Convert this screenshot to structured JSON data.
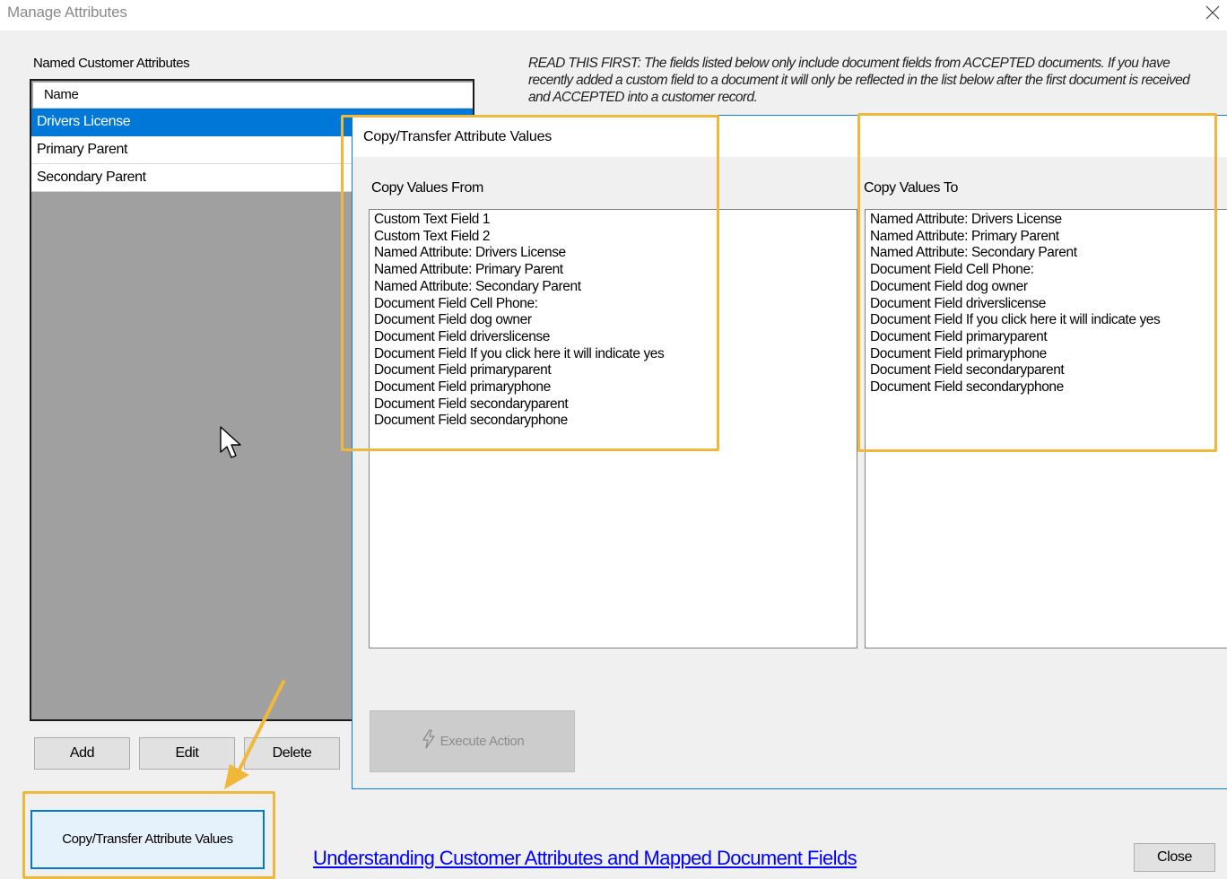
{
  "window": {
    "title": "Manage Attributes"
  },
  "attributes": {
    "heading": "Named Customer Attributes",
    "column_header": "Name",
    "items": [
      {
        "label": "Drivers License",
        "selected": true
      },
      {
        "label": "Primary Parent",
        "selected": false
      },
      {
        "label": "Secondary Parent",
        "selected": false
      }
    ]
  },
  "buttons": {
    "add": "Add",
    "edit": "Edit",
    "delete": "Delete",
    "copy_transfer": "Copy/Transfer Attribute Values",
    "close": "Close"
  },
  "help_link": "Understanding Customer Attributes and Mapped Document Fields",
  "notice": "READ THIS FIRST:  The fields listed below only include document fields from ACCEPTED documents.  If you have recently added a custom field to a document it will only be reflected in the list below after the first document is received and ACCEPTED into a customer record.",
  "dialog": {
    "title": "Copy/Transfer Attribute Values",
    "from_label": "Copy Values From",
    "to_label": "Copy Values To",
    "from_items": [
      "Custom Text Field 1",
      "Custom Text Field 2",
      "Named Attribute: Drivers License",
      "Named Attribute: Primary Parent",
      "Named Attribute: Secondary Parent",
      "Document Field Cell Phone:",
      "Document Field dog owner",
      "Document Field driverslicense",
      "Document Field If you click here it will indicate yes",
      "Document Field primaryparent",
      "Document Field primaryphone",
      "Document Field secondaryparent",
      "Document Field secondaryphone"
    ],
    "to_items": [
      "Named Attribute: Drivers License",
      "Named Attribute: Primary Parent",
      "Named Attribute: Secondary Parent",
      "Document Field Cell Phone:",
      "Document Field dog owner",
      "Document Field driverslicense",
      "Document Field If you click here it will indicate yes",
      "Document Field primaryparent",
      "Document Field primaryphone",
      "Document Field secondaryparent",
      "Document Field secondaryphone"
    ],
    "execute_label": "Execute Action",
    "execute_enabled": false
  },
  "colors": {
    "selection": "#0078d7",
    "highlight": "#f0b83a",
    "link": "#0000ff"
  }
}
